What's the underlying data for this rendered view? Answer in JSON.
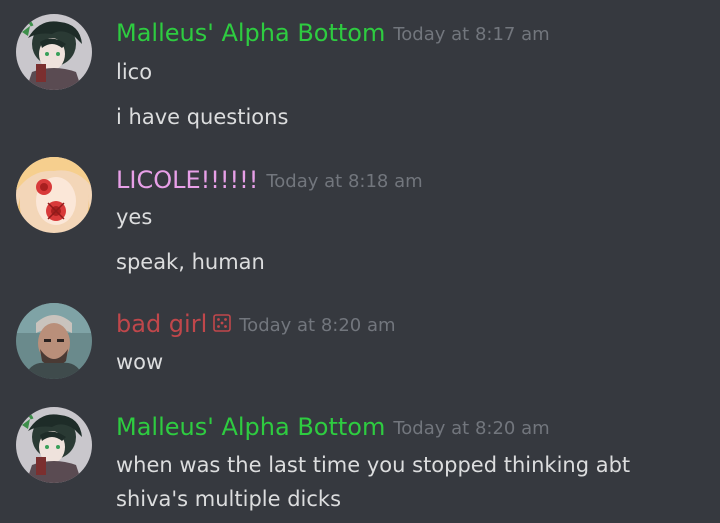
{
  "colors": {
    "background": "#36393f",
    "timestamp": "#72767d",
    "message_text": "#dcddde"
  },
  "messages": [
    {
      "author": "Malleus' Alpha Bottom",
      "author_color": "#2ecc40",
      "timestamp": "Today at 8:17 am",
      "avatar_icon": "anime-character-avatar-icon",
      "lines": [
        "lico",
        "i have questions"
      ]
    },
    {
      "author": "LICOLE!!!!!!",
      "author_color": "#e8a0e8",
      "timestamp": "Today at 8:18 am",
      "avatar_icon": "blonde-rose-avatar-icon",
      "lines": [
        "yes",
        "speak, human"
      ]
    },
    {
      "author": "bad girl",
      "author_color": "#c0474b",
      "badge_icon": "dice-icon",
      "timestamp": "Today at 8:20 am",
      "avatar_icon": "bearded-man-avatar-icon",
      "lines": [
        "wow"
      ]
    },
    {
      "author": "Malleus' Alpha Bottom",
      "author_color": "#2ecc40",
      "timestamp": "Today at 8:20 am",
      "avatar_icon": "anime-character-avatar-icon",
      "lines": [
        "when was the last time you stopped thinking abt shiva's multiple dicks"
      ]
    }
  ]
}
